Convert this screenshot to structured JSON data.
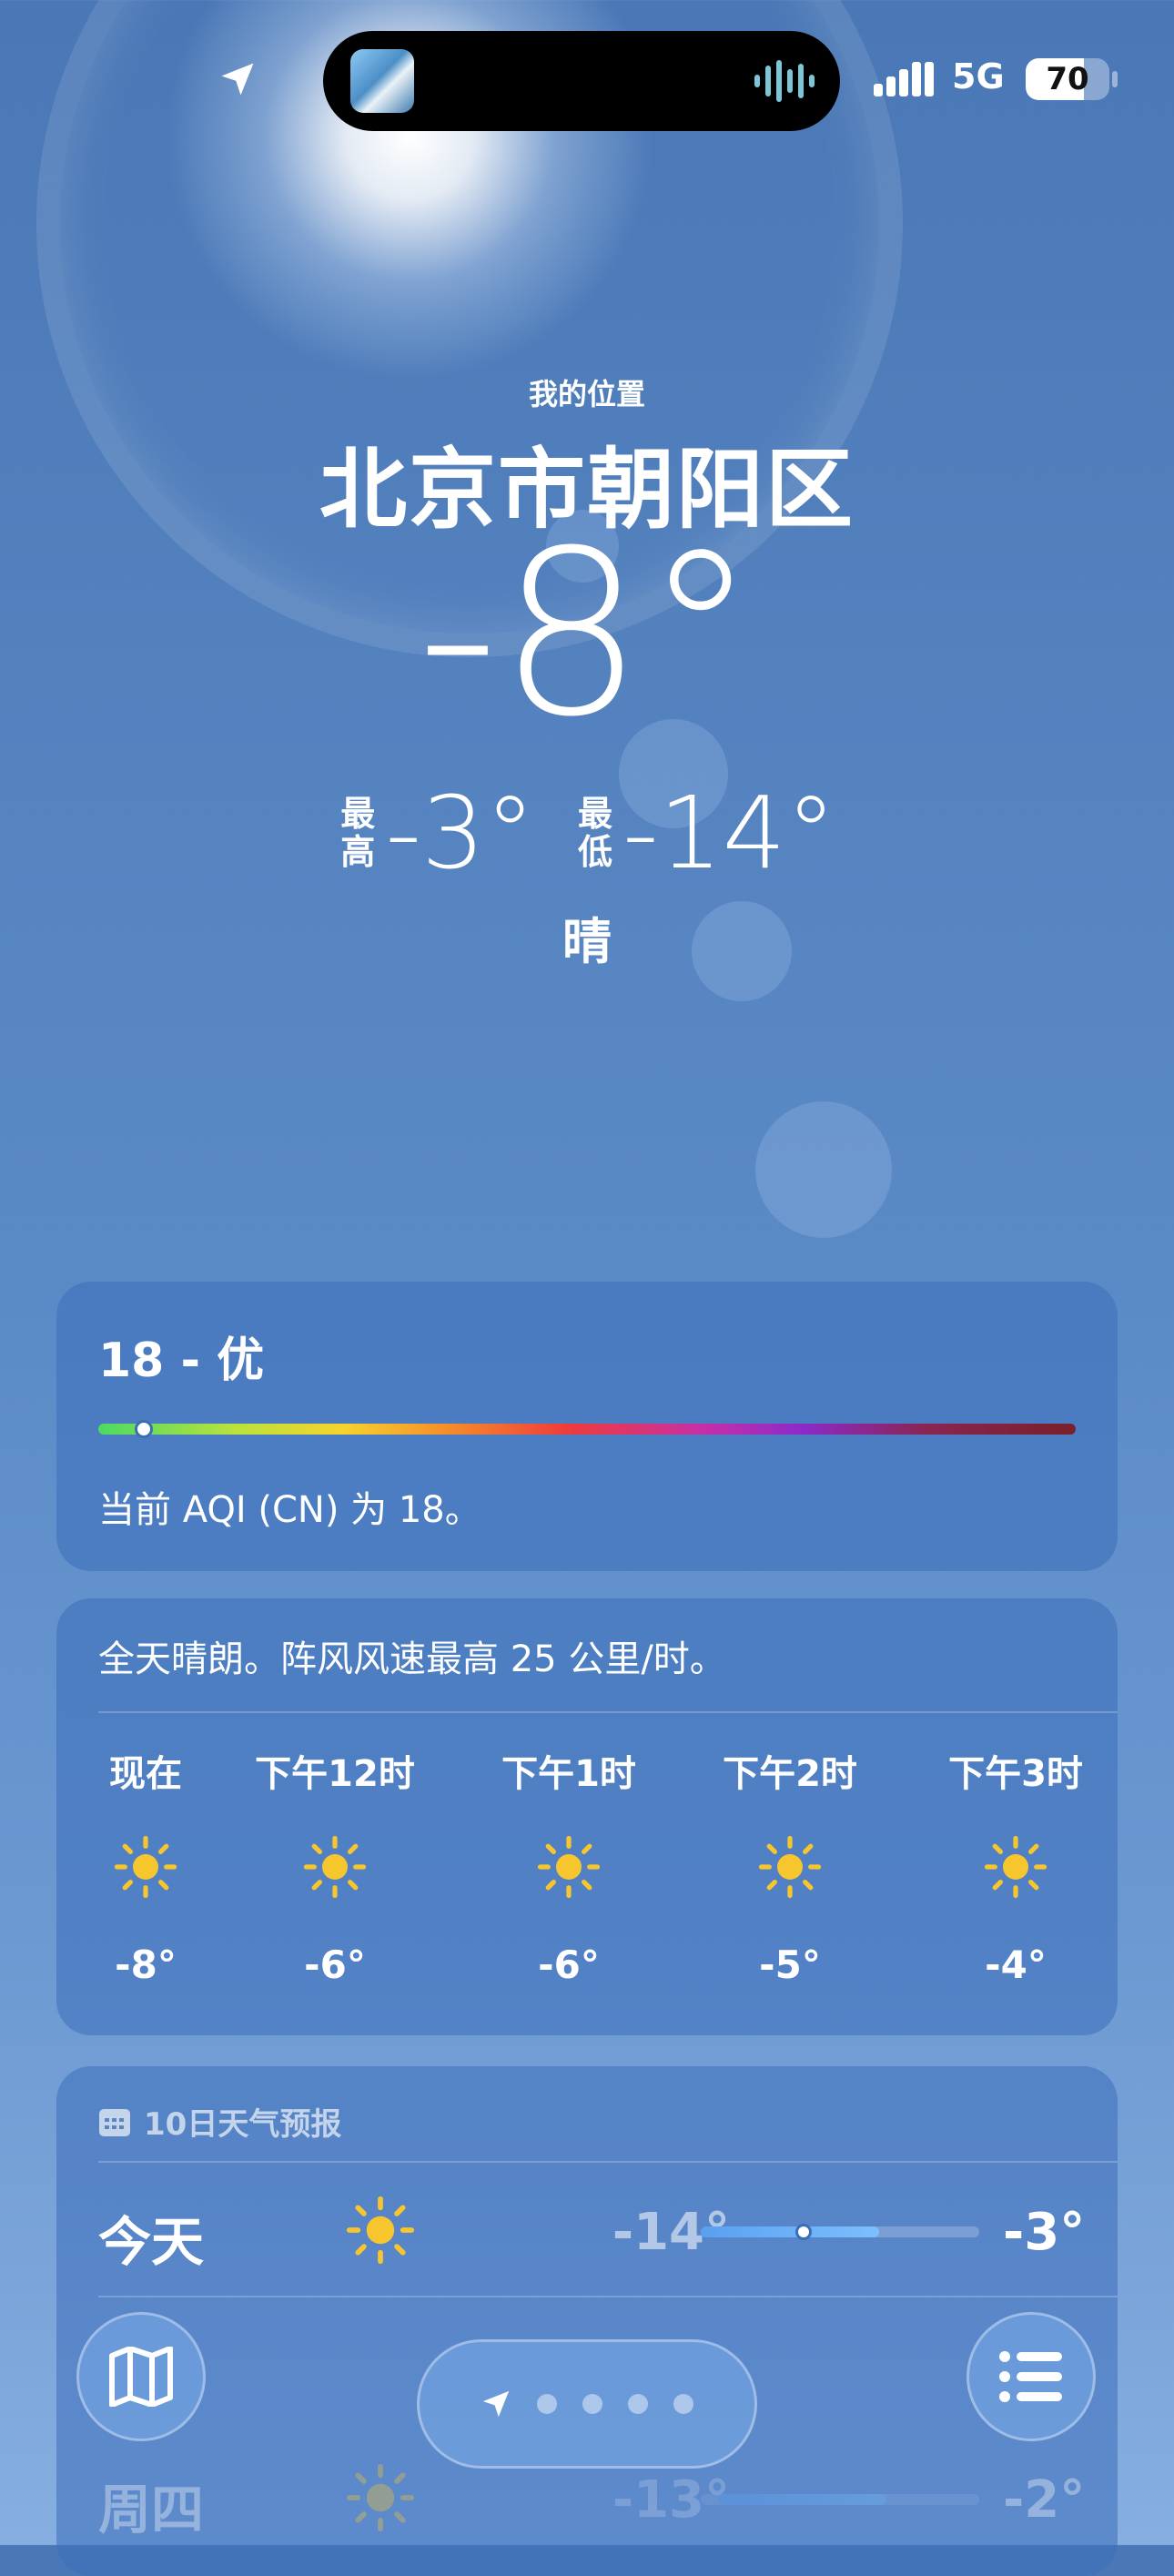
{
  "status_bar": {
    "network": "5G",
    "battery": "70",
    "battery_level": 0.7
  },
  "header": {
    "my_location": "我的位置",
    "city": "北京市朝阳区",
    "temperature": "-8°",
    "high_label": "最高",
    "high": "-3°",
    "low_label": "最低",
    "low": "-14°",
    "condition": "晴"
  },
  "aqi": {
    "title": "18 - 优",
    "value": 18,
    "description": "当前 AQI (CN) 为 18。"
  },
  "hourly": {
    "summary": "全天晴朗。阵风风速最高 25 公里/时。",
    "hours": [
      {
        "label": "现在",
        "temp": "-8°",
        "icon": "sun-icon"
      },
      {
        "label": "下午12时",
        "temp": "-6°",
        "icon": "sun-icon"
      },
      {
        "label": "下午1时",
        "temp": "-6°",
        "icon": "sun-icon"
      },
      {
        "label": "下午2时",
        "temp": "-5°",
        "icon": "sun-icon"
      },
      {
        "label": "下午3时",
        "temp": "-4°",
        "icon": "sun-icon"
      }
    ]
  },
  "ten_day": {
    "title": "10日天气预报",
    "days": [
      {
        "name": "今天",
        "icon": "sun-icon",
        "low": "-14°",
        "high": "-3°"
      },
      {
        "name": "周四",
        "icon": "sun-icon",
        "low": "-13°",
        "high": "-2°"
      }
    ]
  },
  "colors": {
    "accent": "#4a78b6",
    "sun": "#f7c62f"
  }
}
